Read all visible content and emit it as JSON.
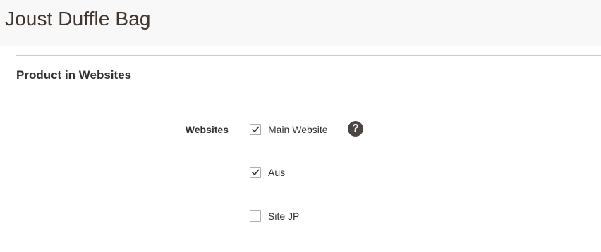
{
  "page": {
    "title": "Joust Duffle Bag"
  },
  "section": {
    "title": "Product in Websites"
  },
  "websites_field": {
    "label": "Websites",
    "help_icon": "question-mark-icon",
    "help_glyph": "?",
    "options": [
      {
        "label": "Main Website",
        "checked": true
      },
      {
        "label": "Aus",
        "checked": true
      },
      {
        "label": "Site JP",
        "checked": false
      }
    ]
  },
  "colors": {
    "title_text": "#41362f",
    "header_bg": "#f8f8f8",
    "help_icon_bg": "#4a4542",
    "checkbox_border": "#adadad"
  }
}
